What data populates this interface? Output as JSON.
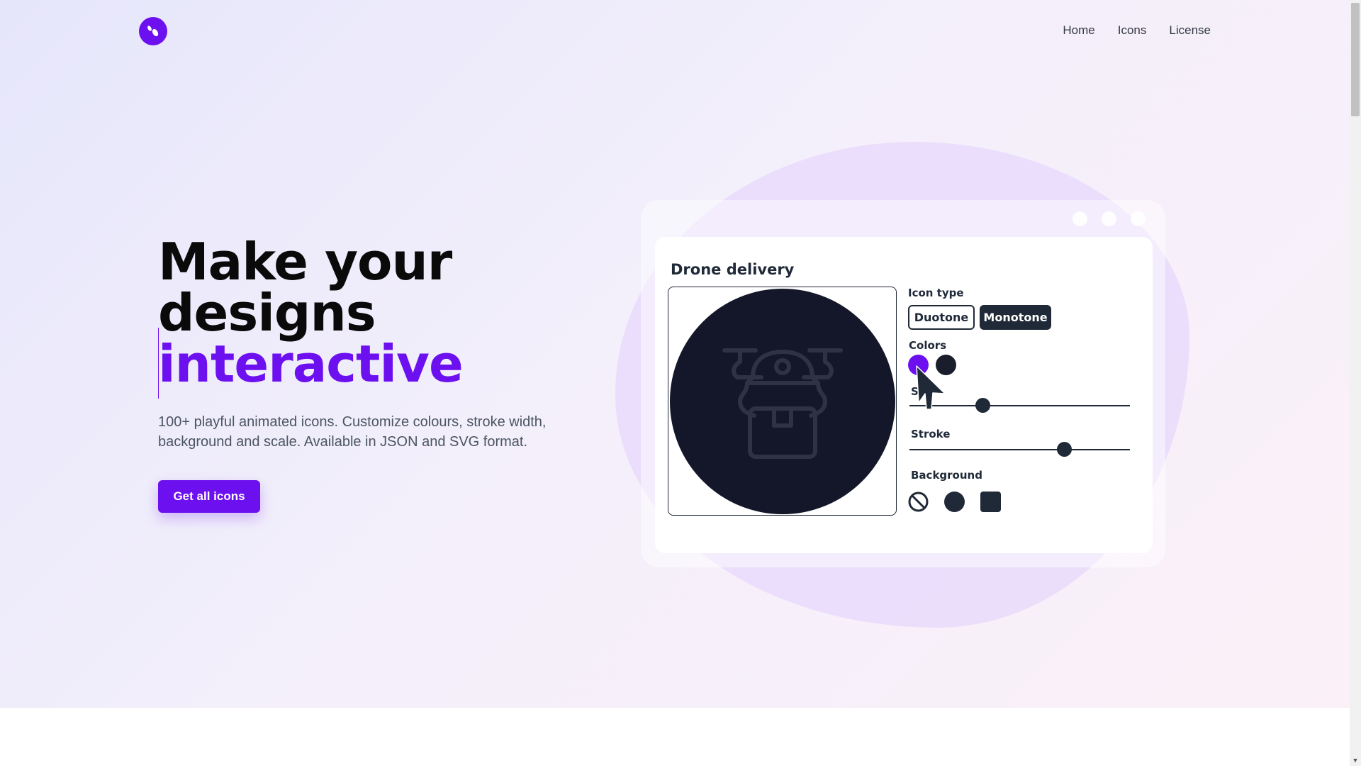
{
  "nav": {
    "logo_icon": "droplets-logo-icon",
    "items": [
      {
        "label": "Home"
      },
      {
        "label": "Icons"
      },
      {
        "label": "License"
      }
    ]
  },
  "hero": {
    "headline_line1": "Make your",
    "headline_line2": "designs",
    "headline_accent": "interactive",
    "subtitle": "100+ playful animated icons. Customize colours, stroke width, background and scale. Available in JSON and SVG format.",
    "cta_label": "Get all icons"
  },
  "demo": {
    "title": "Drone delivery",
    "preview_icon": "drone-delivery-icon",
    "icon_type_label": "Icon type",
    "icon_type_options": [
      "Duotone",
      "Monotone"
    ],
    "icon_type_selected": "Monotone",
    "colors_label": "Colors",
    "colors": [
      "#6d10f0",
      "#1a1d2b"
    ],
    "scale_label": "S",
    "scale_value": 0.33,
    "stroke_label": "Stroke",
    "stroke_value": 0.7,
    "background_label": "Background",
    "background_options": [
      "none",
      "circle",
      "square"
    ],
    "background_selected": "circle"
  },
  "colors": {
    "accent": "#6d10f0",
    "dark": "#1f2937",
    "preview_bg": "#141729"
  }
}
